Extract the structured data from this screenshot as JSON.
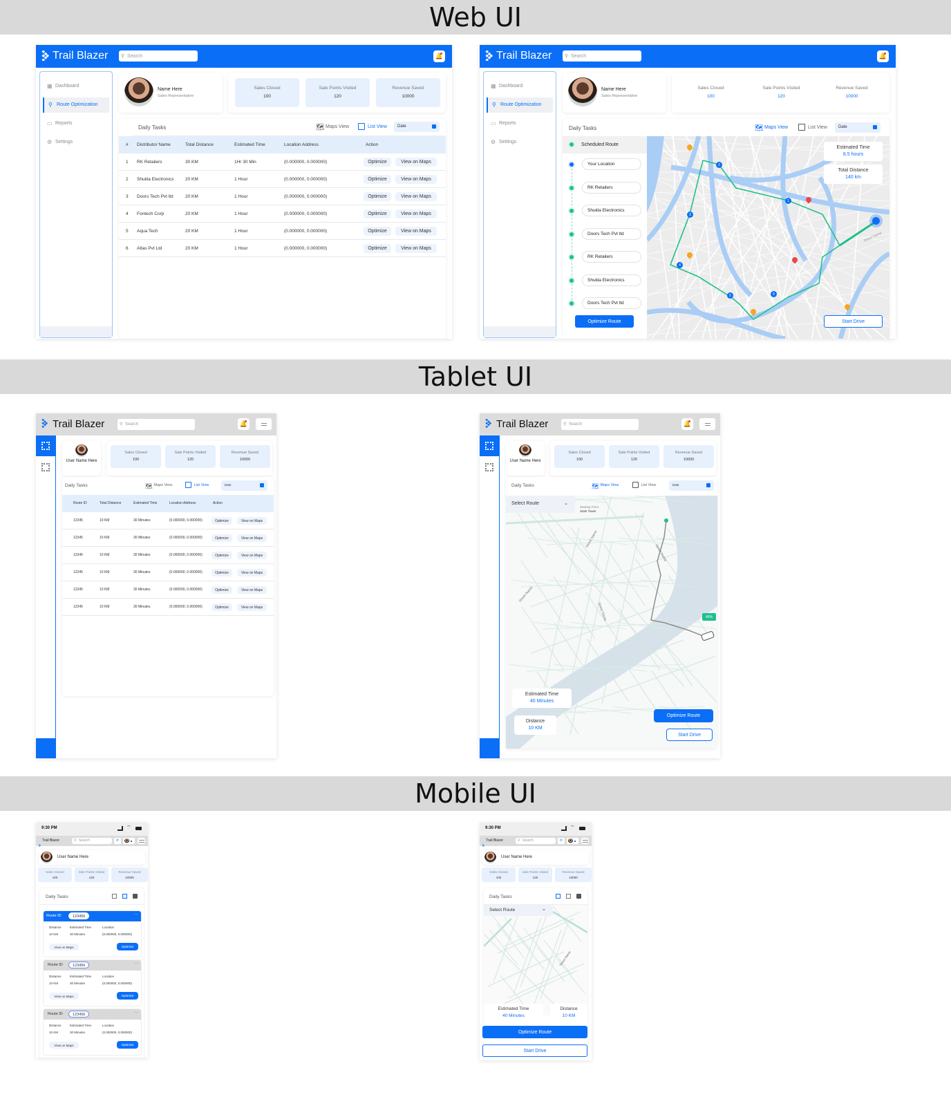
{
  "sections": {
    "web": "Web UI",
    "tablet": "Tablet UI",
    "mobile": "Mobile UI"
  },
  "app": {
    "name": "Trail Blazer",
    "search_placeholder": "Search"
  },
  "sidebar": {
    "items": [
      "Dashboard",
      "Route Optimization",
      "Reports",
      "Settings"
    ]
  },
  "profile": {
    "name": "Name Here",
    "role": "Sales Representative",
    "user_name": "User Name Here"
  },
  "stats": [
    {
      "label": "Sales Closed",
      "value": "100"
    },
    {
      "label": "Sale Points Visited",
      "value": "120"
    },
    {
      "label": "Revenue Saved",
      "value": "10000"
    }
  ],
  "tasks": {
    "title": "Daily Tasks",
    "maps_view": "Maps View",
    "list_view": "List View",
    "date": "Date"
  },
  "actions": {
    "optimize": "Optimize",
    "view_on_maps": "View on Maps"
  },
  "web_table": {
    "headers": [
      "#",
      "Distributor Name",
      "Total Distance",
      "Estimated Time",
      "Location Address",
      "Action"
    ],
    "rows": [
      [
        "1",
        "RK Retailers",
        "30 KM",
        "1Hr 30 Min",
        "(0.000000, 0.000000)"
      ],
      [
        "2",
        "Shukla Electronics",
        "20 KM",
        "1 Hour",
        "(0.000000, 0.000000)"
      ],
      [
        "3",
        "Doors Tech Pvt ltd",
        "20 KM",
        "1 Hour",
        "(0.000000, 0.000000)"
      ],
      [
        "4",
        "Fontech Corp",
        "20 KM",
        "1 Hour",
        "(0.000000, 0.000000)"
      ],
      [
        "5",
        "Aqua Tech",
        "20 KM",
        "1 Hour",
        "(0.000000, 0.000000)"
      ],
      [
        "6",
        "Atlas Pvt Ltd",
        "20 KM",
        "1 Hour",
        "(0.000000, 0.000000)"
      ]
    ]
  },
  "route_panel": {
    "title": "Scheduled Route",
    "stops": [
      "Your Location",
      "RK Retailers",
      "Shukla Electronics",
      "Doors Tech Pvt ltd",
      "RK Retailers",
      "Shukla Electronics",
      "Doors Tech Pvt ltd"
    ],
    "optimize": "Optimize Route",
    "start": "Start Drive"
  },
  "web_map": {
    "est_label": "Estimated Time",
    "est": "8.5 hours",
    "dist_label": "Total Distance",
    "dist": "140 km",
    "street": "Street Name",
    "markers": [
      "1",
      "2",
      "3",
      "4",
      "5",
      "6"
    ]
  },
  "tablet_table": {
    "headers": [
      "Route ID",
      "Total Distance",
      "Estimated Time",
      "Location Address",
      "Action"
    ],
    "rows": [
      [
        "12345",
        "10 KM",
        "30 Minutes",
        "(0.000000, 0.000000)"
      ],
      [
        "12345",
        "10 KM",
        "30 Minutes",
        "(0.000000, 0.000000)"
      ],
      [
        "12345",
        "10 KM",
        "30 Minutes",
        "(0.000000, 0.000000)"
      ],
      [
        "12345",
        "10 KM",
        "30 Minutes",
        "(0.000000, 0.000000)"
      ],
      [
        "12345",
        "10 KM",
        "30 Minutes",
        "(0.000000, 0.000000)"
      ],
      [
        "12345",
        "10 KM",
        "30 Minutes",
        "(0.000000, 0.000000)"
      ]
    ]
  },
  "tablet_map": {
    "select": "Select Route",
    "start_label": "Starting Point",
    "start_name": "Stark Tower",
    "progress": "45%",
    "est_label": "Estimated Time",
    "est": "40 Minutes",
    "dist_label": "Distance",
    "dist": "10 KM",
    "street": "Street Name"
  },
  "mobile": {
    "time": "9:30 PM",
    "cards": [
      {
        "route_label": "Route ID",
        "route_id": "123456"
      },
      {
        "route_label": "Route ID",
        "route_id": "123456"
      },
      {
        "route_label": "Route ID",
        "route_id": "123456"
      }
    ],
    "distance_label": "Distance",
    "distance": "10 KM",
    "time_label": "Estimated Time",
    "time_value": "30 Minutes",
    "location_label": "Location",
    "location": "(0.000000, 0.000000)"
  },
  "colors": {
    "primary": "#0b6ef6",
    "route": "#1fbf8f",
    "stat_bg": "#e7f0fd"
  }
}
